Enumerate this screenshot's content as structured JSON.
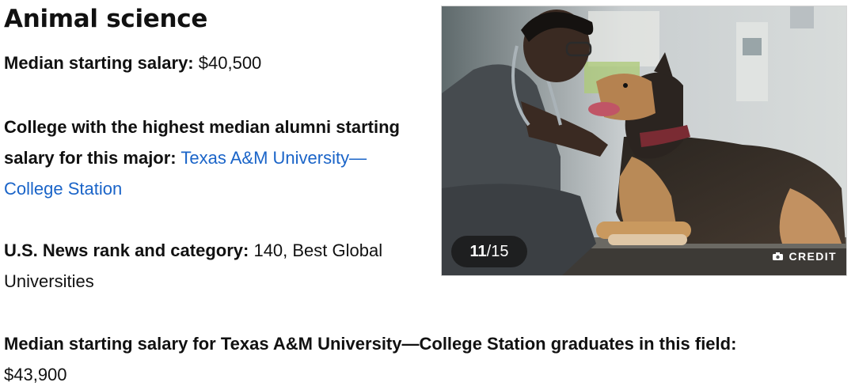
{
  "title": "Animal science",
  "salary": {
    "label": "Median starting salary:",
    "value": "$40,500"
  },
  "college": {
    "label": "College with the highest median alumni starting salary for this major:",
    "link": "Texas A&M University—College Station"
  },
  "rank": {
    "label": "U.S. News rank and category:",
    "value": "140, Best Global Universities"
  },
  "texas_salary": {
    "label": "Median starting salary for Texas A&M University—College Station graduates in this field:",
    "value": "$43,900"
  },
  "slideshow": {
    "current": "11",
    "total": "/15",
    "credit_label": "CREDIT",
    "credit_icon": "camera-icon"
  }
}
